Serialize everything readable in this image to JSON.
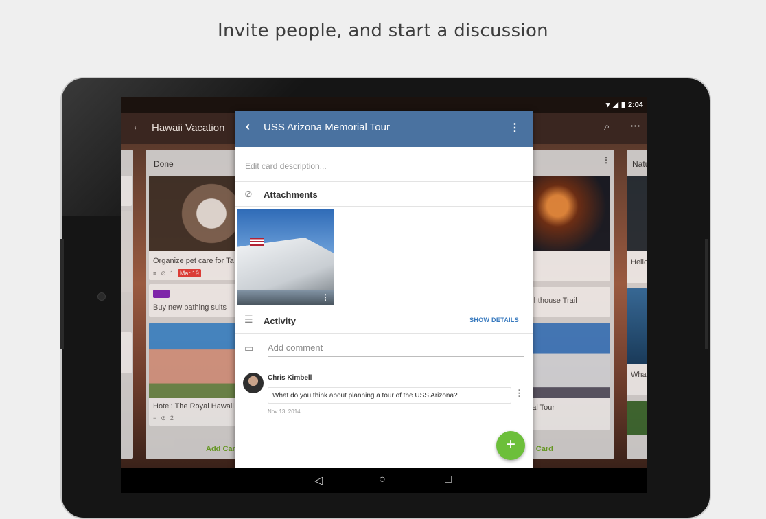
{
  "headline": "Invite people, and start a discussion",
  "status_bar": {
    "time": "2:04",
    "wifi_icon": "wifi-icon",
    "signal_icon": "signal-icon",
    "battery_icon": "battery-icon"
  },
  "board": {
    "title": "Hawaii Vacation",
    "lists": [
      {
        "title": "Done",
        "cards": [
          {
            "title": "Organize pet care for Ta",
            "attachments": "1",
            "due": "Mar 19"
          },
          {
            "title": "Buy new bathing suits",
            "label_color": "#7c1fb8"
          },
          {
            "title": "Hotel: The Royal Hawaii",
            "attachments": "2"
          }
        ],
        "add_card": "Add Card"
      },
      {
        "title": "",
        "cards": [
          {
            "title": "Lighthouse Trail"
          },
          {
            "title": "orial Tour"
          }
        ],
        "add_card": "d Card"
      },
      {
        "title": "Natu",
        "cards": [
          {
            "title": "Helic"
          },
          {
            "title": "Wha"
          }
        ]
      }
    ]
  },
  "card_detail": {
    "title": "USS Arizona Memorial Tour",
    "description_placeholder": "Edit card description...",
    "attachments_label": "Attachments",
    "activity_label": "Activity",
    "show_details": "SHOW DETAILS",
    "add_comment_placeholder": "Add comment",
    "comments": [
      {
        "author": "Chris Kimbell",
        "text": "What do you think about planning a tour of the USS Arizona?",
        "date": "Nov 13, 2014"
      }
    ],
    "fab_label": "+"
  },
  "nav": {
    "back_icon": "back-triangle-icon",
    "home_icon": "home-circle-icon",
    "recents_icon": "recents-square-icon"
  },
  "colors": {
    "header": "#4a72a0",
    "fab": "#6cbf3a",
    "link": "#3a7bbf"
  }
}
